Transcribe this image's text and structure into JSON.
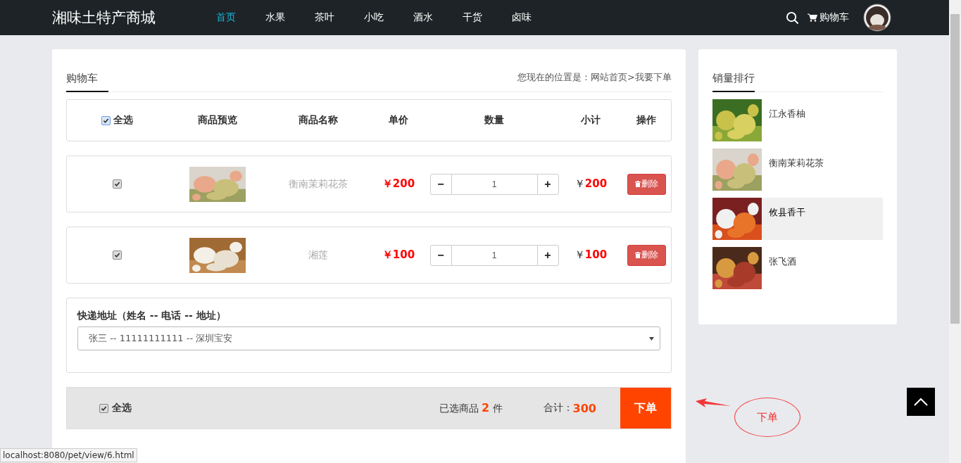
{
  "navbar": {
    "brand": "湘味土特产商城",
    "links": [
      {
        "label": "首页",
        "selected": true
      },
      {
        "label": "水果",
        "selected": false
      },
      {
        "label": "茶叶",
        "selected": false
      },
      {
        "label": "小吃",
        "selected": false
      },
      {
        "label": "酒水",
        "selected": false
      },
      {
        "label": "干货",
        "selected": false
      },
      {
        "label": "卤味",
        "selected": false
      }
    ],
    "cart": "购物车"
  },
  "cart": {
    "title": "购物车",
    "breadcrumb": "您现在的位置是：网站首页>我要下单",
    "header": {
      "select_all": {
        "label": "全选",
        "checked": true
      },
      "columns": [
        "商品预览",
        "商品名称",
        "单价",
        "数量",
        "小计",
        "操作"
      ]
    },
    "items": [
      {
        "checked": true,
        "name": "衡南茉莉花茶",
        "price": "￥200",
        "quantity": "1",
        "subtotal": "￥**200**",
        "delete": "删除",
        "minus": "−",
        "plus": "+"
      },
      {
        "checked": true,
        "name": "湘莲",
        "price": "￥100",
        "quantity": "1",
        "subtotal": "￥**100**",
        "delete": "删除",
        "minus": "−",
        "plus": "+"
      }
    ],
    "address": {
      "label": "快递地址（姓名 -- 电话 -- 地址）",
      "value": "张三 -- 11111111111 -- 深圳宝安"
    },
    "footer": {
      "select_all": {
        "label": "全选",
        "checked": true
      },
      "count": "已选商品 **2** 件",
      "total_label": "合计：",
      "total": "300",
      "submit": "下单"
    }
  },
  "ranking": {
    "title": "销量排行",
    "items": [
      {
        "name": "江永香柚",
        "selected": false
      },
      {
        "name": "衡南茉莉花茶",
        "selected": false
      },
      {
        "name": "攸县香干",
        "selected": true
      },
      {
        "name": "张飞酒",
        "selected": false
      }
    ]
  },
  "annotation": {
    "label": "下单"
  },
  "status_url": "localhost:8080/pet/view/6.html"
}
